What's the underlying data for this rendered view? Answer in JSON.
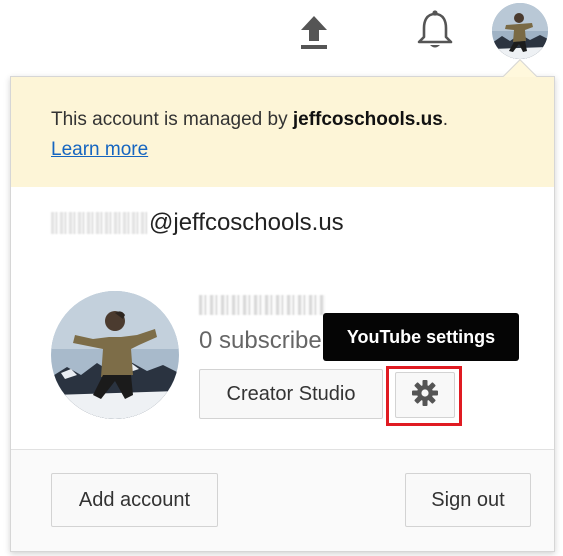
{
  "topbar": {
    "icons": [
      "upload-icon",
      "notifications-bell-icon",
      "account-avatar"
    ]
  },
  "managed_notice": {
    "prefix": "This account is managed by ",
    "domain": "jeffcoschools.us",
    "suffix": ".",
    "learn_more": "Learn more",
    "background": "#fdf5d7"
  },
  "account": {
    "email_visible": "@jeffcoschools.us",
    "subscribers": "0 subscribers"
  },
  "buttons": {
    "creator_studio": "Creator Studio",
    "add_account": "Add account",
    "sign_out": "Sign out"
  },
  "settings": {
    "icon": "gear-icon",
    "tooltip": "YouTube settings",
    "highlight_color": "#e01b22"
  },
  "colors": {
    "link": "#1565c0",
    "tooltip_bg": "#050505"
  }
}
